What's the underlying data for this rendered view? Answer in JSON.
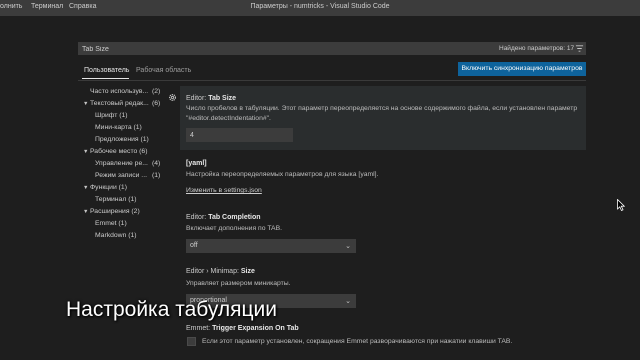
{
  "titlebar": {
    "menu": [
      "олнить",
      "Терминал",
      "Справка"
    ],
    "window_title": "Параметры - numtricks - Visual Studio Code"
  },
  "search": {
    "value": "Tab Size",
    "results_label": "Найдено параметров: 17"
  },
  "tabs": {
    "user": "Пользователь",
    "workspace": "Рабочая область"
  },
  "sync_button": "Включить синхронизацию параметров",
  "toc": [
    {
      "label": "Часто использув...",
      "count": "(2)"
    },
    {
      "label": "Текстовый редак...",
      "count": "(6)"
    },
    {
      "label": "Шрифт (1)"
    },
    {
      "label": "Мини-карта (1)"
    },
    {
      "label": "Предложения (1)"
    },
    {
      "label": "Рабочее место (6)"
    },
    {
      "label": "Управление ре...",
      "count": "(4)"
    },
    {
      "label": "Режим записи ...",
      "count": "(1)"
    },
    {
      "label": "Функции (1)"
    },
    {
      "label": "Терминал (1)"
    },
    {
      "label": "Расширения (2)"
    },
    {
      "label": "Emmet (1)"
    },
    {
      "label": "Markdown (1)"
    }
  ],
  "settings": {
    "tab_size": {
      "category": "Editor: ",
      "name": "Tab Size",
      "desc1": "Число пробелов в табуляции. Этот параметр переопределяется на основе содержимого файла, если установлен параметр",
      "desc2": "\"#editor.detectIndentation#\".",
      "value": "4"
    },
    "yaml": {
      "title": "[yaml]",
      "desc": "Настройка переопределяемых параметров для языка [yaml].",
      "link": "Изменить в settings.json"
    },
    "tab_completion": {
      "category": "Editor: ",
      "name": "Tab Completion",
      "desc": "Включает дополнения по TAB.",
      "value": "off"
    },
    "minimap_size": {
      "category": "Editor › Minimap: ",
      "name": "Size",
      "desc": "Управляет размером миникарты.",
      "value": "proportional"
    },
    "emmet_trigger": {
      "category": "Emmet: ",
      "name": "Trigger Expansion On Tab",
      "desc": "Если этот параметр установлен, сокращения Emmet разворачиваются при нажатии клавиши TAB."
    }
  },
  "caption": "Настройка табуляции",
  "icons": {
    "gear": "gear-icon",
    "clear": "clear-filter-icon",
    "chevron": "chevron-down-icon",
    "cursor": "mouse-cursor-icon"
  },
  "colors": {
    "accent": "#0e639c",
    "background": "#1e1e1e",
    "titlebar": "#3c3c3c"
  }
}
